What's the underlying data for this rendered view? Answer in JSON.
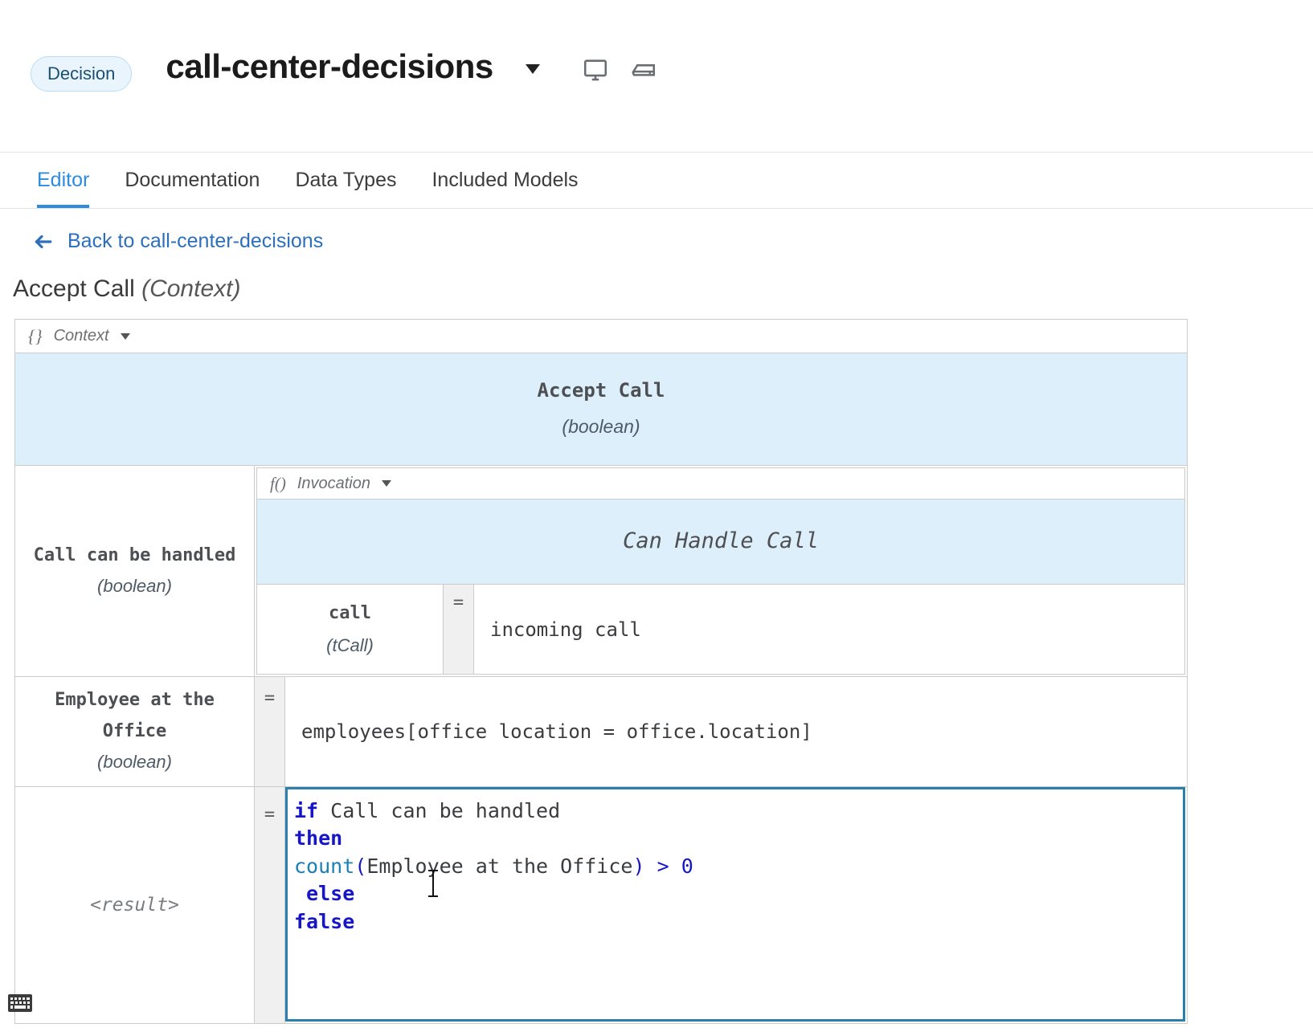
{
  "header": {
    "badge": "Decision",
    "title": "call-center-decisions",
    "caret_icon": "chevron-down-icon",
    "icons": [
      {
        "name": "monitor-icon",
        "label": "Monitor"
      },
      {
        "name": "server-icon",
        "label": "Server"
      }
    ]
  },
  "tabs": [
    {
      "label": "Editor",
      "active": true
    },
    {
      "label": "Documentation",
      "active": false
    },
    {
      "label": "Data Types",
      "active": false
    },
    {
      "label": "Included Models",
      "active": false
    }
  ],
  "breadcrumb": {
    "arrow_icon": "arrow-left-icon",
    "back_label": "Back to call-center-decisions"
  },
  "page": {
    "title": "Accept Call",
    "kind": "(Context)"
  },
  "context": {
    "type_icon_glyph": "{}",
    "type_label": "Context",
    "output": {
      "name": "Accept Call",
      "type": "(boolean)"
    },
    "entries": [
      {
        "name": "Call can be handled",
        "type": "(boolean)",
        "nested": {
          "type_icon_glyph": "f()",
          "type_label": "Invocation",
          "invoked": "Can Handle Call",
          "params": [
            {
              "name": "call",
              "type": "(tCall)",
              "equals": "=",
              "value": "incoming call"
            }
          ]
        }
      },
      {
        "name": "Employee at the Office",
        "type": "(boolean)",
        "equals": "=",
        "expression": "employees[office location = office.location]"
      }
    ],
    "result": {
      "label": "<result>",
      "equals": "=",
      "code_lines": [
        [
          {
            "t": "if ",
            "c": "kw"
          },
          {
            "t": "Call can be handled",
            "c": "id"
          }
        ],
        [
          {
            "t": "then",
            "c": "kw"
          }
        ],
        [
          {
            "t": "count",
            "c": "fn"
          },
          {
            "t": "(",
            "c": "op"
          },
          {
            "t": "Employee at the Office",
            "c": "id"
          },
          {
            "t": ")",
            "c": "op"
          },
          {
            "t": " > ",
            "c": "op"
          },
          {
            "t": "0",
            "c": "num"
          }
        ],
        [
          {
            "t": " else",
            "c": "kw"
          }
        ],
        [
          {
            "t": "false",
            "c": "kw"
          }
        ]
      ]
    }
  },
  "statusbar": {
    "keyboard_icon": "keyboard-icon"
  },
  "colors": {
    "accent": "#2d8ce0",
    "link": "#2c6fbb",
    "header_cell_bg": "#ddeffb",
    "editor_border": "#2b7fab",
    "keyword": "#1616c8",
    "function": "#1a80b8",
    "grid": "#c9cbcd"
  }
}
